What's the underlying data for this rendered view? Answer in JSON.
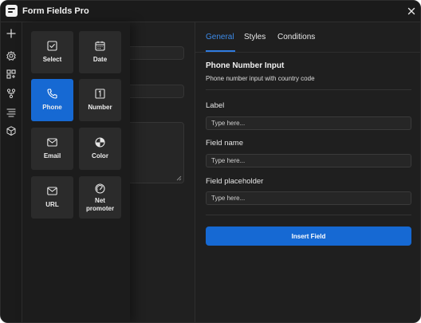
{
  "app": {
    "title": "Form Fields Pro"
  },
  "field_types": [
    {
      "label": "Select",
      "icon": "checkbox-icon",
      "selected": false
    },
    {
      "label": "Date",
      "icon": "calendar-icon",
      "selected": false
    },
    {
      "label": "Phone",
      "icon": "phone-icon",
      "selected": true
    },
    {
      "label": "Number",
      "icon": "number-box-icon",
      "selected": false
    },
    {
      "label": "Email",
      "icon": "envelope-icon",
      "selected": false
    },
    {
      "label": "Color",
      "icon": "color-wheel-icon",
      "selected": false
    },
    {
      "label": "URL",
      "icon": "envelope-icon",
      "selected": false
    },
    {
      "label": "Net\npromoter",
      "icon": "gauge-icon",
      "selected": false
    }
  ],
  "tabs": [
    {
      "label": "General",
      "active": true
    },
    {
      "label": "Styles",
      "active": false
    },
    {
      "label": "Conditions",
      "active": false
    }
  ],
  "settings": {
    "title": "Phone Number Input",
    "description": "Phone number input with country code",
    "label_label": "Label",
    "label_placeholder": "Type here...",
    "name_label": "Field name",
    "name_placeholder": "Type here...",
    "placeholder_label": "Field placeholder",
    "placeholder_placeholder": "Type here...",
    "insert_button": "Insert Field"
  },
  "colors": {
    "accent": "#1669d3",
    "active_tab": "#3d8bea",
    "background": "#1f1f1f"
  }
}
